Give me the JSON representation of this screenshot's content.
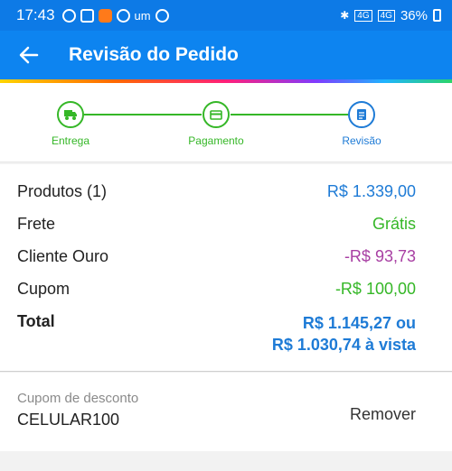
{
  "statusbar": {
    "time": "17:43",
    "carrier_small": "um",
    "signal_label_1": "4G",
    "signal_label_2": "4G",
    "battery": "36%"
  },
  "appbar": {
    "title": "Revisão do Pedido"
  },
  "stepper": {
    "steps": [
      {
        "label": "Entrega",
        "icon": "truck-icon",
        "state": "done"
      },
      {
        "label": "Pagamento",
        "icon": "credit-card-icon",
        "state": "done"
      },
      {
        "label": "Revisão",
        "icon": "document-icon",
        "state": "active"
      }
    ],
    "colors": {
      "done": "#35b727",
      "active": "#1e7bd6"
    }
  },
  "summary": {
    "rows": [
      {
        "label": "Produtos (1)",
        "value": "R$ 1.339,00",
        "color": "#1e7bd6"
      },
      {
        "label": "Frete",
        "value": "Grátis",
        "color": "#35b727"
      },
      {
        "label": "Cliente Ouro",
        "value": "-R$ 93,73",
        "color": "#a83fa3"
      },
      {
        "label": "Cupom",
        "value": "-R$ 100,00",
        "color": "#35b727"
      }
    ],
    "total": {
      "label": "Total",
      "value_line1": "R$ 1.145,27 ou",
      "value_line2": "R$ 1.030,74 à vista"
    }
  },
  "coupon": {
    "caption": "Cupom de desconto",
    "code": "CELULAR100",
    "remove_label": "Remover"
  }
}
